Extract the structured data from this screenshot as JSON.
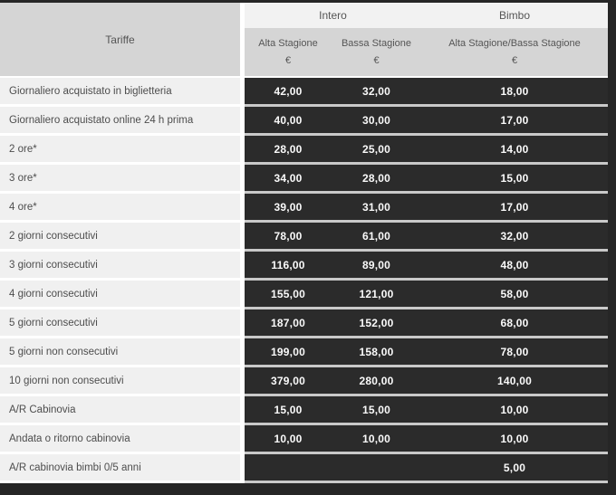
{
  "table": {
    "corner_label": "Tariffe",
    "groups": [
      {
        "label": "Intero",
        "colspan": 2
      },
      {
        "label": "Bimbo",
        "colspan": 1
      }
    ],
    "columns": [
      {
        "label": "Alta Stagione",
        "currency": "€"
      },
      {
        "label": "Bassa Stagione",
        "currency": "€"
      },
      {
        "label": "Alta Stagione/Bassa Stagione",
        "currency": "€"
      }
    ],
    "rows": [
      {
        "label": "Giornaliero acquistato in biglietteria",
        "values": [
          "42,00",
          "32,00",
          "18,00"
        ]
      },
      {
        "label": "Giornaliero acquistato online 24 h prima",
        "values": [
          "40,00",
          "30,00",
          "17,00"
        ]
      },
      {
        "label": "2 ore*",
        "values": [
          "28,00",
          "25,00",
          "14,00"
        ]
      },
      {
        "label": "3 ore*",
        "values": [
          "34,00",
          "28,00",
          "15,00"
        ]
      },
      {
        "label": "4 ore*",
        "values": [
          "39,00",
          "31,00",
          "17,00"
        ]
      },
      {
        "label": "2 giorni consecutivi",
        "values": [
          "78,00",
          "61,00",
          "32,00"
        ]
      },
      {
        "label": "3 giorni consecutivi",
        "values": [
          "116,00",
          "89,00",
          "48,00"
        ]
      },
      {
        "label": "4 giorni consecutivi",
        "values": [
          "155,00",
          "121,00",
          "58,00"
        ]
      },
      {
        "label": "5 giorni consecutivi",
        "values": [
          "187,00",
          "152,00",
          "68,00"
        ]
      },
      {
        "label": "5 giorni non consecutivi",
        "values": [
          "199,00",
          "158,00",
          "78,00"
        ]
      },
      {
        "label": "10 giorni non consecutivi",
        "values": [
          "379,00",
          "280,00",
          "140,00"
        ]
      },
      {
        "label": "A/R Cabinovia",
        "values": [
          "15,00",
          "15,00",
          "10,00"
        ]
      },
      {
        "label": "Andata o ritorno cabinovia",
        "values": [
          "10,00",
          "10,00",
          "10,00"
        ]
      },
      {
        "label": "A/R cabinovia bimbi 0/5 anni",
        "values": [
          "",
          "",
          "5,00"
        ]
      }
    ]
  },
  "colors": {
    "frame_dark": "#262626",
    "value_cell_dark": "#2b2b2b",
    "header_gray": "#d5d5d5",
    "group_band_light": "#f2f2f2",
    "label_cell_light": "#f0f0f0",
    "value_text": "#fafafa",
    "label_text": "#4d4d4d",
    "dark_row_separator": "#c9c9c9",
    "light_row_separator": "#ffffff"
  }
}
